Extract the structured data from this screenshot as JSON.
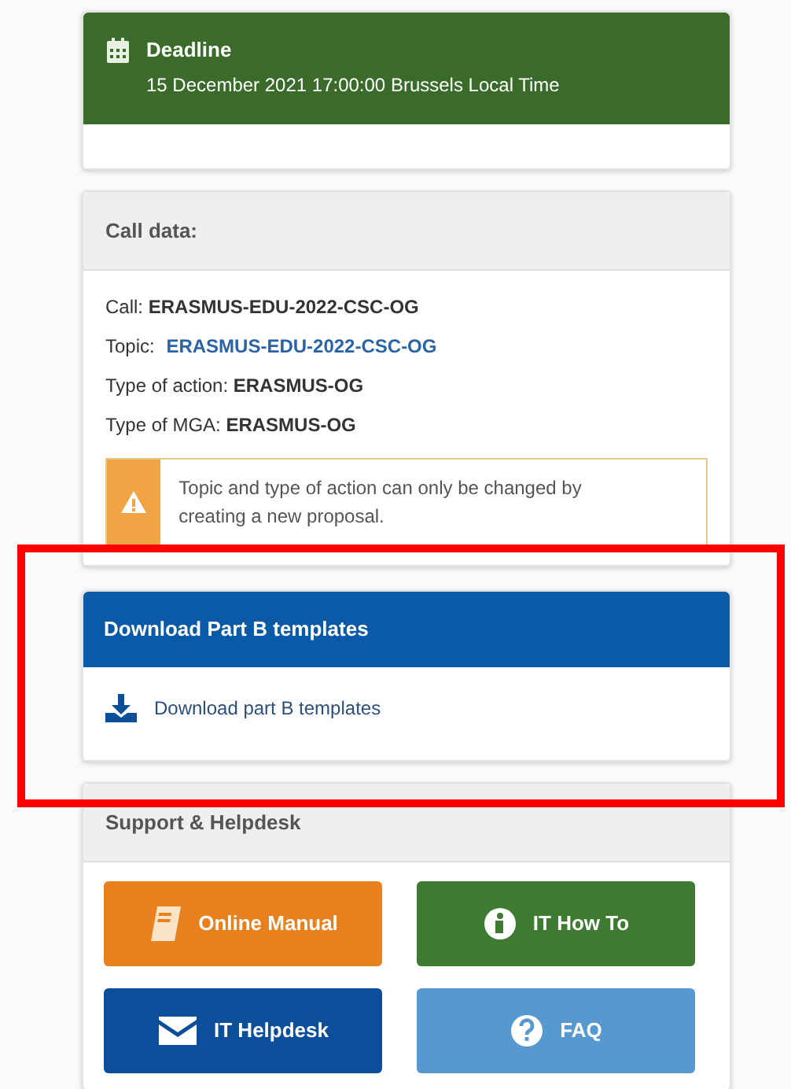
{
  "deadline": {
    "title": "Deadline",
    "date": "15 December 2021 17:00:00 Brussels Local Time"
  },
  "call_data": {
    "title": "Call data:",
    "fields": [
      {
        "label": "Call:",
        "value": "ERASMUS-EDU-2022-CSC-OG",
        "kind": "text"
      },
      {
        "label": "Topic:",
        "value": "ERASMUS-EDU-2022-CSC-OG",
        "kind": "link"
      },
      {
        "label": "Type of action:",
        "value": "ERASMUS-OG",
        "kind": "text"
      },
      {
        "label": "Type of MGA:",
        "value": "ERASMUS-OG",
        "kind": "text"
      }
    ],
    "warning": "Topic and type of action can only be changed by creating a new proposal."
  },
  "download": {
    "title": "Download Part B templates",
    "link": "Download part B templates",
    "highlighted": true
  },
  "support": {
    "title": "Support & Helpdesk",
    "buttons": [
      {
        "label": "Online Manual",
        "color": "#e8801e"
      },
      {
        "label": "IT How To",
        "color": "#3f7a32"
      },
      {
        "label": "IT Helpdesk",
        "color": "#0b4f9a"
      },
      {
        "label": "FAQ",
        "color": "#5699d0"
      }
    ]
  }
}
